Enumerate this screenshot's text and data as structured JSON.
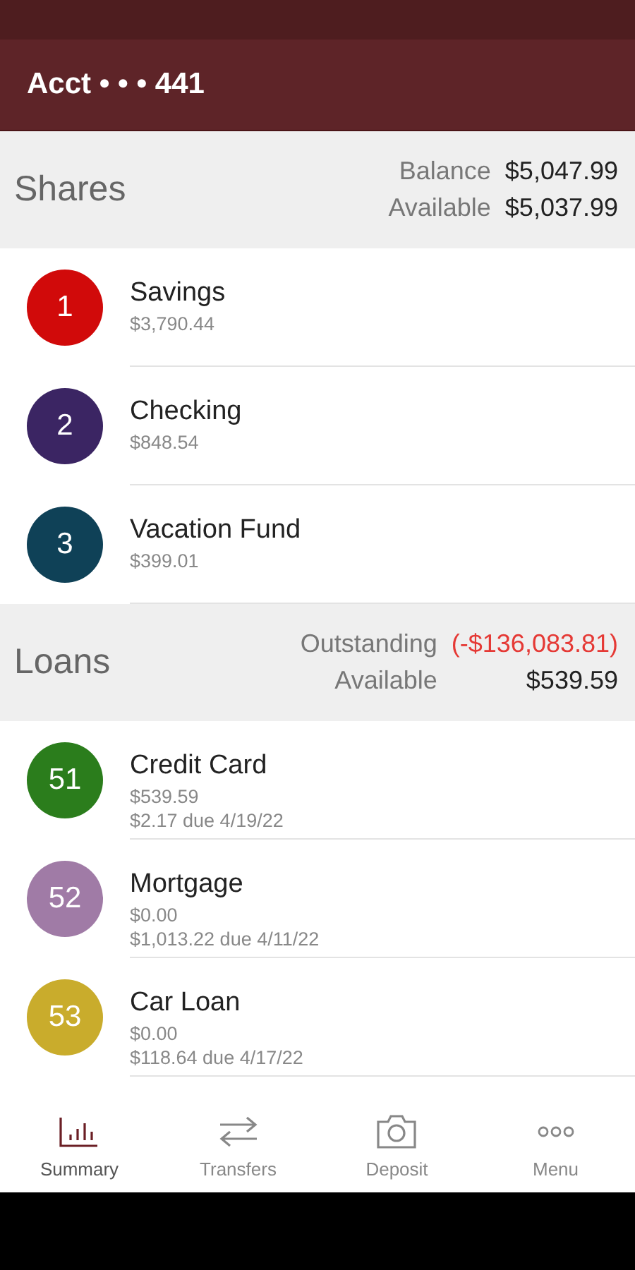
{
  "header": {
    "title": "Acct • • • 441"
  },
  "sections": [
    {
      "title": "Shares",
      "totals": [
        {
          "label": "Balance",
          "value": "$5,047.99",
          "negative": false
        },
        {
          "label": "Available",
          "value": "$5,037.99",
          "negative": false
        }
      ],
      "accounts": [
        {
          "badge": "1",
          "color": "#d10a0a",
          "name": "Savings",
          "details": [
            "$3,790.44"
          ]
        },
        {
          "badge": "2",
          "color": "#3b2563",
          "name": "Checking",
          "details": [
            "$848.54"
          ]
        },
        {
          "badge": "3",
          "color": "#0f4157",
          "name": "Vacation Fund",
          "details": [
            "$399.01"
          ]
        }
      ]
    },
    {
      "title": "Loans",
      "totals": [
        {
          "label": "Outstanding",
          "value": "(-$136,083.81)",
          "negative": true
        },
        {
          "label": "Available",
          "value": "$539.59",
          "negative": false
        }
      ],
      "accounts": [
        {
          "badge": "51",
          "color": "#2b7d1c",
          "name": "Credit Card",
          "details": [
            "$539.59",
            "$2.17 due 4/19/22"
          ]
        },
        {
          "badge": "52",
          "color": "#a07ba6",
          "name": "Mortgage",
          "details": [
            "$0.00",
            "$1,013.22 due 4/11/22"
          ]
        },
        {
          "badge": "53",
          "color": "#c9ac2c",
          "name": "Car Loan",
          "details": [
            "$0.00",
            "$118.64 due 4/17/22"
          ]
        }
      ]
    }
  ],
  "tabs": [
    {
      "label": "Summary",
      "selected": true
    },
    {
      "label": "Transfers",
      "selected": false
    },
    {
      "label": "Deposit",
      "selected": false
    },
    {
      "label": "Menu",
      "selected": false
    }
  ]
}
